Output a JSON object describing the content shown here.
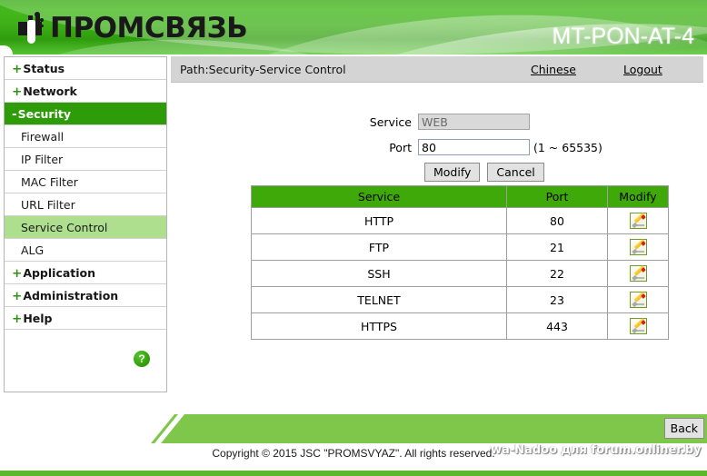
{
  "header": {
    "brand_text": "ПРОМСВЯЗЬ",
    "brand_icon": "plug-connector-icon",
    "model": "MT-PON-AT-4",
    "banner_color": "#3fb018"
  },
  "sidebar": {
    "items": [
      {
        "label": "Status",
        "sign": "+",
        "type": "top",
        "state": "collapsed"
      },
      {
        "label": "Network",
        "sign": "+",
        "type": "top",
        "state": "collapsed"
      },
      {
        "label": "Security",
        "sign": "-",
        "type": "top",
        "state": "expanded-active"
      },
      {
        "label": "Firewall",
        "sign": "",
        "type": "sub",
        "state": "normal"
      },
      {
        "label": "IP Filter",
        "sign": "",
        "type": "sub",
        "state": "normal"
      },
      {
        "label": "MAC Filter",
        "sign": "",
        "type": "sub",
        "state": "normal"
      },
      {
        "label": "URL Filter",
        "sign": "",
        "type": "sub",
        "state": "normal"
      },
      {
        "label": "Service Control",
        "sign": "",
        "type": "sub",
        "state": "selected"
      },
      {
        "label": "ALG",
        "sign": "",
        "type": "sub",
        "state": "normal"
      },
      {
        "label": "Application",
        "sign": "+",
        "type": "top",
        "state": "collapsed"
      },
      {
        "label": "Administration",
        "sign": "+",
        "type": "top",
        "state": "collapsed"
      },
      {
        "label": "Help",
        "sign": "+",
        "type": "top",
        "state": "collapsed"
      }
    ],
    "help_icon_label": "?",
    "active_color": "#2e9c08",
    "selected_color": "#addf8f"
  },
  "pathbar": {
    "path": "Path:Security-Service Control",
    "chinese_link": "Chinese",
    "logout_link": "Logout"
  },
  "form": {
    "service_label": "Service",
    "service_value": "WEB",
    "port_label": "Port",
    "port_value": "80",
    "port_hint": "(1 ~ 65535)",
    "modify_button": "Modify",
    "cancel_button": "Cancel"
  },
  "table": {
    "headers": [
      "Service",
      "Port",
      "Modify"
    ],
    "header_color": "#3fa909",
    "modify_icon": "pencil-edit-icon",
    "rows": [
      {
        "service": "HTTP",
        "port": "80"
      },
      {
        "service": "FTP",
        "port": "21"
      },
      {
        "service": "SSH",
        "port": "22"
      },
      {
        "service": "TELNET",
        "port": "23"
      },
      {
        "service": "HTTPS",
        "port": "443"
      }
    ]
  },
  "footer": {
    "back_button": "Back",
    "copyright": "Copyright © 2015 JSC \"PROMSVYAZ\". All rights reserved.",
    "watermark": "wa-Nadoo для forum.onliner.by",
    "band_color": "#7fc74a"
  }
}
